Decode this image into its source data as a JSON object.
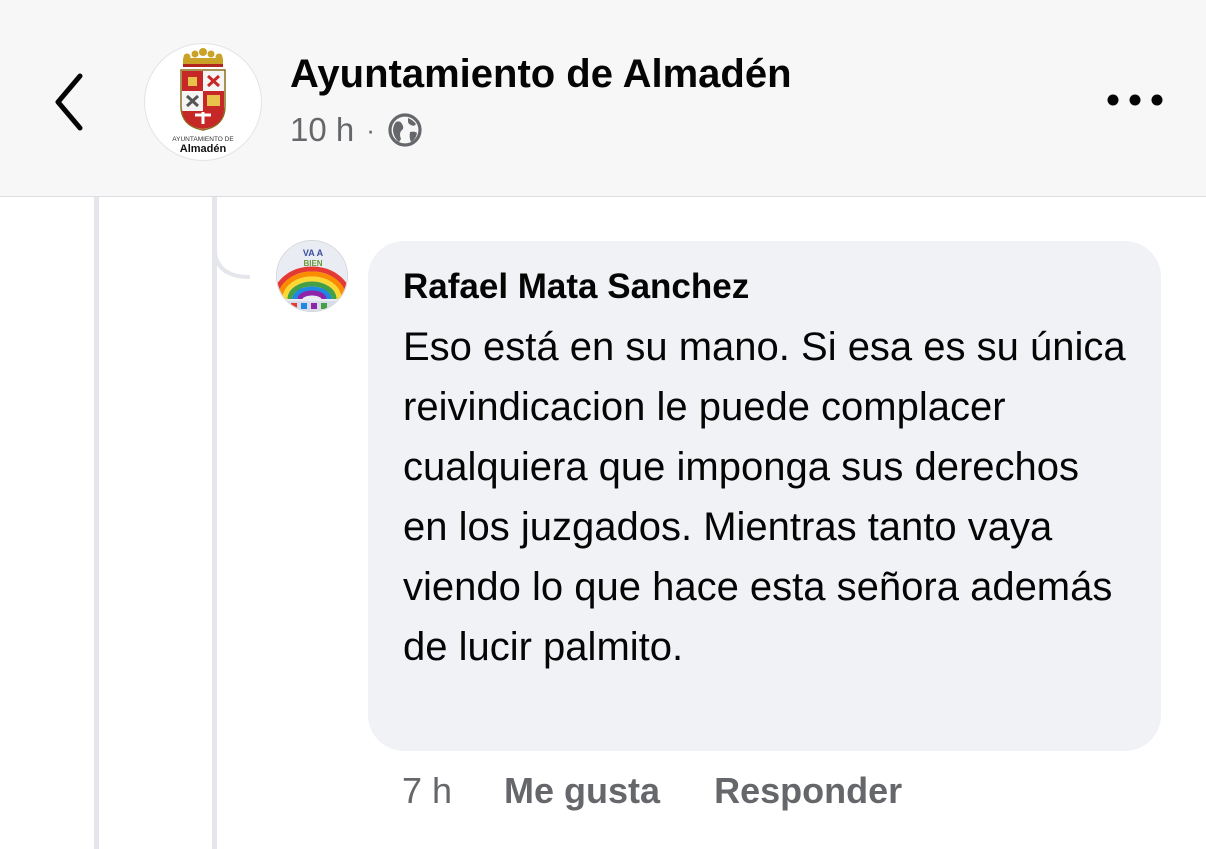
{
  "header": {
    "back_icon": "chevron-left-icon",
    "page_name": "Ayuntamiento de Almadén",
    "post_time": "10 h",
    "separator": "·",
    "audience_icon": "globe-icon",
    "more_icon": "more-horizontal-icon",
    "logo": {
      "label_small": "AYUNTAMIENTO DE",
      "label_big": "Almadén"
    }
  },
  "comment": {
    "author": "Rafael Mata Sanchez",
    "avatar_text": [
      "VA A",
      "BIEN"
    ],
    "text": "Eso está en su mano. Si esa es su única reivindicacion le puede complacer cualquiera que imponga sus derechos en los juzgados. Mientras tanto vaya viendo lo que hace esta señora además de lucir palmito.",
    "time": "7 h",
    "like_label": "Me gusta",
    "reply_label": "Responder"
  },
  "colors": {
    "header_bg": "#f7f7f8",
    "bubble_bg": "#f0f2f5",
    "text_primary": "#050505",
    "text_secondary": "#65676b",
    "thread_line": "#e4e6eb"
  }
}
